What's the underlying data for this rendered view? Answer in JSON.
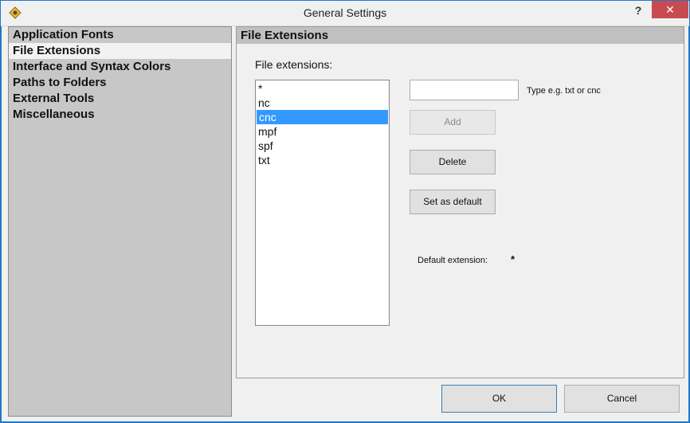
{
  "window": {
    "title": "General Settings",
    "help_label": "?",
    "close_label": "✕"
  },
  "sidebar": {
    "items": [
      {
        "label": "Application Fonts"
      },
      {
        "label": "File Extensions"
      },
      {
        "label": "Interface and Syntax Colors"
      },
      {
        "label": "Paths to Folders"
      },
      {
        "label": "External Tools"
      },
      {
        "label": "Miscellaneous"
      }
    ],
    "selected_index": 1
  },
  "panel": {
    "header": "File Extensions",
    "extensions_label": "File extensions:",
    "extensions": [
      "*",
      "nc",
      "cnc",
      "mpf",
      "spf",
      "txt"
    ],
    "selected_extension": "cnc",
    "input_value": "",
    "input_hint": "Type e.g. txt or cnc",
    "add_label": "Add",
    "delete_label": "Delete",
    "set_default_label": "Set as default",
    "default_label": "Default extension:",
    "default_value": "*"
  },
  "footer": {
    "ok_label": "OK",
    "cancel_label": "Cancel"
  },
  "colors": {
    "accent": "#1e78c8",
    "selection": "#3399ff",
    "close": "#c74b50"
  }
}
